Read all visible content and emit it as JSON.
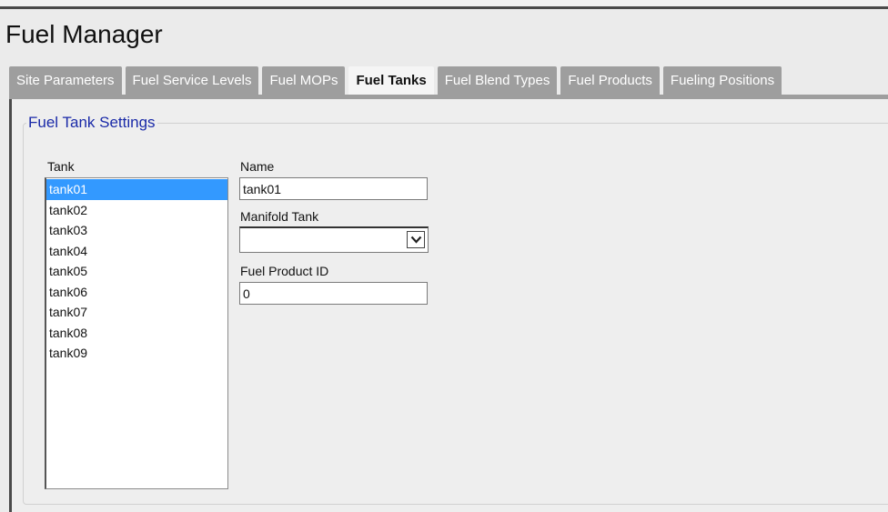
{
  "app": {
    "title": "Fuel Manager"
  },
  "tabs": [
    {
      "label": "Site Parameters",
      "active": false
    },
    {
      "label": "Fuel Service Levels",
      "active": false
    },
    {
      "label": "Fuel MOPs",
      "active": false
    },
    {
      "label": "Fuel Tanks",
      "active": true
    },
    {
      "label": "Fuel Blend Types",
      "active": false
    },
    {
      "label": "Fuel Products",
      "active": false
    },
    {
      "label": "Fueling Positions",
      "active": false
    }
  ],
  "settings": {
    "legend": "Fuel Tank Settings",
    "tank_label": "Tank",
    "tanks": [
      "tank01",
      "tank02",
      "tank03",
      "tank04",
      "tank05",
      "tank06",
      "tank07",
      "tank08",
      "tank09"
    ],
    "selected_tank": "tank01",
    "name_label": "Name",
    "name_value": "tank01",
    "manifold_label": "Manifold Tank",
    "manifold_value": "",
    "product_id_label": "Fuel Product ID",
    "product_id_value": "0"
  },
  "colors": {
    "accent": "#3399ff",
    "legend": "#1a2aa8",
    "tab_inactive": "#9e9e9e"
  },
  "icons": {
    "select_arrow": "chevron-down-icon"
  }
}
